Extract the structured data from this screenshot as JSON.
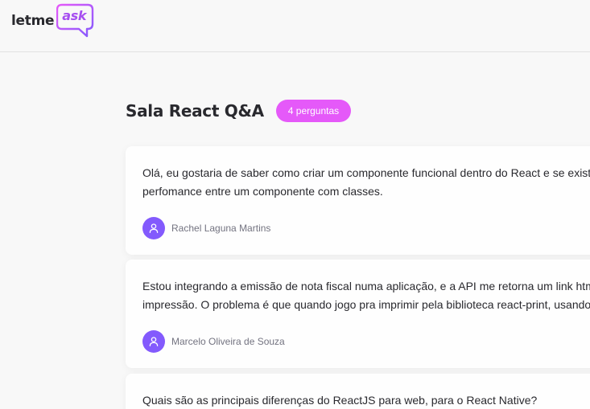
{
  "header": {
    "logo_text": "letme",
    "logo_bubble_text": "ask"
  },
  "room": {
    "title": "Sala React Q&A",
    "question_count_label": "4 perguntas"
  },
  "questions": [
    {
      "line1": "Olá, eu gostaria de saber como criar um componente funcional dentro do React e se existe diferença na",
      "line2": "perfomance entre um componente com classes.",
      "author": "Rachel Laguna Martins"
    },
    {
      "line1": "Estou integrando a emissão de nota fiscal numa aplicação, e a API me retorna um link html para",
      "line2": "impressão. O problema é que quando jogo pra imprimir pela biblioteca react-print, usando",
      "author": "Marcelo Oliveira de Souza"
    },
    {
      "line1": "Quais são as principais diferenças do ReactJS para web, para o React Native?"
    }
  ],
  "colors": {
    "brand_purple": "#835afd",
    "badge_pink": "#e559f9",
    "logo_gradient_start": "#e559f9",
    "logo_gradient_end": "#835afd"
  },
  "icons": {
    "avatar": "user-icon",
    "logo": "speech-bubble-icon"
  }
}
